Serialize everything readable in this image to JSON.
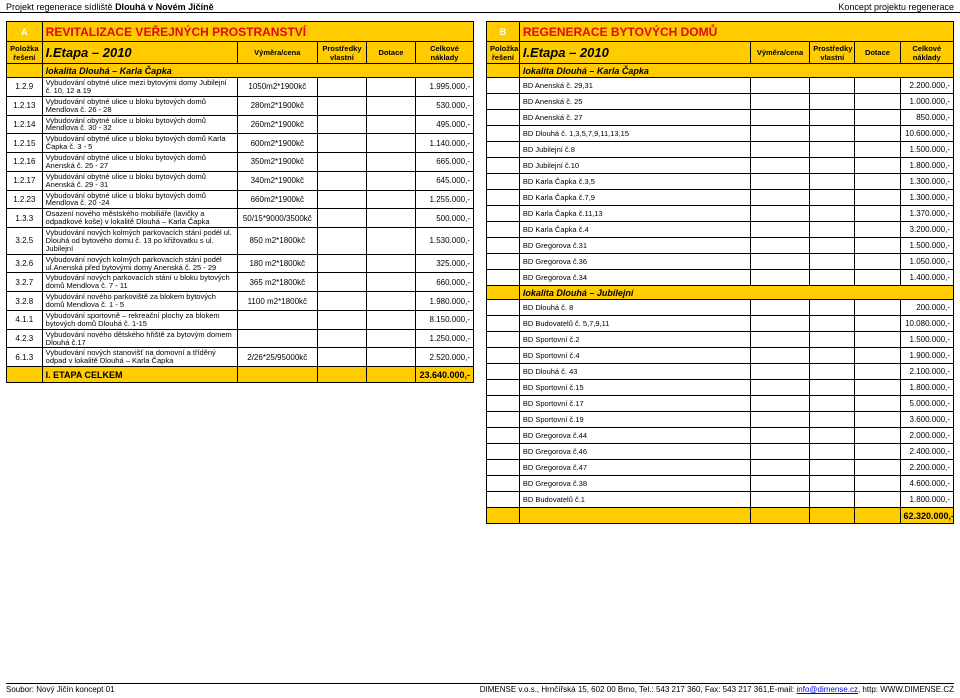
{
  "header": {
    "left_prefix": "Projekt regenerace sídliště ",
    "left_bold": "Dlouhá v Novém Jičíně",
    "right": "Koncept projektu regenerace"
  },
  "footer": {
    "left": "Soubor: Nový Jičín koncept 01",
    "right_plain": "DIMENSE v.o.s., Hrnčířská 15, 602 00 Brno, Tel.: 543 217 360, Fax: 543 217 361,E-mail: ",
    "right_link": "info@dimense.cz",
    "right_tail": ", http: WWW.DIMENSE.CZ"
  },
  "tableA": {
    "letter": "A",
    "title": "REVITALIZACE VEŘEJNÝCH PROSTRANSTVÍ",
    "etapa_label": "I.Etapa – 2010",
    "col_labels": {
      "polozka": "Položka řešení",
      "vymera": "Výměra/cena",
      "prostredky": "Prostředky vlastní",
      "dotace": "Dotace",
      "celkove": "Celkové náklady"
    },
    "sub1": "lokalita Dlouhá – Karla Čapka",
    "rows": [
      {
        "id": "1.2.9",
        "desc": "Vybudování obytné ulice mezi bytovými domy Jubilejní č. 10, 12 a 19",
        "rate": "1050m2*1900kč",
        "cost": "1.995.000,-"
      },
      {
        "id": "1.2.13",
        "desc": "Vybudování obytné ulice u bloku bytových domů Mendlova č. 26 - 28",
        "rate": "280m2*1900kč",
        "cost": "530.000,-"
      },
      {
        "id": "1.2.14",
        "desc": "Vybudování obytné ulice u bloku bytových domů Mendlova č. 30 - 32",
        "rate": "260m2*1900kč",
        "cost": "495.000,-"
      },
      {
        "id": "1.2.15",
        "desc": "Vybudování obytné ulice u bloku bytových domů Karla Čapka č. 3 - 5",
        "rate": "600m2*1900kč",
        "cost": "1.140.000,-"
      },
      {
        "id": "1.2.16",
        "desc": "Vybudování obytné ulice u bloku bytových domů Anenská č. 25 - 27",
        "rate": "350m2*1900kč",
        "cost": "665.000,-"
      },
      {
        "id": "1.2.17",
        "desc": "Vybudování obytné ulice u bloku bytových domů Anenská č. 29 - 31",
        "rate": "340m2*1900kč",
        "cost": "645.000,-"
      },
      {
        "id": "1.2.23",
        "desc": "Vybudování obytné ulice u bloku bytových domů Mendlova č. 20 -24",
        "rate": "660m2*1900kč",
        "cost": "1.255.000,-"
      },
      {
        "id": "1.3.3",
        "desc": "Osazení nového městského mobiliáře (lavičky a odpadkové koše) v lokalitě Dlouhá – Karla Čapka",
        "rate": "50/15*9000/3500kč",
        "cost": "500.000,-"
      },
      {
        "id": "3.2.5",
        "desc": "Vybudování nových kolmých parkovacích stání podél ul. Dlouhá od bytového domu č. 13 po křižovatku s ul. Jubilejní",
        "rate": "850 m2*1800kč",
        "cost": "1.530.000,-"
      },
      {
        "id": "3.2.6",
        "desc": "Vybudování nových kolmých parkovacích stání podél ul.Anenská před bytovými domy Anenská č. 25 - 29",
        "rate": "180 m2*1800kč",
        "cost": "325.000,-"
      },
      {
        "id": "3.2.7",
        "desc": "Vybudování nových parkovacích stání u bloku bytových domů Mendlova č. 7 - 11",
        "rate": "365 m2*1800kč",
        "cost": "660.000,-"
      },
      {
        "id": "3.2.8",
        "desc": "Vybudování nového parkoviště za blokem bytových domů Mendlova č. 1 - 5",
        "rate": "1100 m2*1800kč",
        "cost": "1.980.000,-"
      },
      {
        "id": "4.1.1",
        "desc": "Vybudování sportovně – rekreační plochy za blokem bytových domů Dlouhá č. 1-15",
        "rate": "",
        "cost": "8.150.000,-"
      },
      {
        "id": "4.2.3",
        "desc": "Vybudování nového dětského hřiště za bytovým domem Dlouhá č.17",
        "rate": "",
        "cost": "1.250.000,-"
      },
      {
        "id": "6.1.3",
        "desc": "Vybudování nových stanovišť na domovní a tříděný odpad v lokalitě Dlouhá – Karla Čapka",
        "rate": "2/26*25/95000kč",
        "cost": "2.520.000,-"
      }
    ],
    "total_label": "I. ETAPA CELKEM",
    "total_value": "23.640.000,-"
  },
  "tableB": {
    "letter": "B",
    "title": "REGENERACE BYTOVÝCH DOMŮ",
    "etapa_label": "I.Etapa – 2010",
    "col_labels": {
      "polozka": "Položka řešení",
      "vymera": "Výměra/cena",
      "prostredky": "Prostředky vlastní",
      "dotace": "Dotace",
      "celkove": "Celkové náklady"
    },
    "sub1": "lokalita Dlouhá – Karla Čapka",
    "rows1": [
      {
        "desc": "BD Anenská č. 29,31",
        "cost": "2.200.000,-"
      },
      {
        "desc": "BD Anenská č. 25",
        "cost": "1.000.000,-"
      },
      {
        "desc": "BD Anenská č. 27",
        "cost": "850.000,-"
      },
      {
        "desc": "BD Dlouhá č. 1,3,5,7,9,11,13,15",
        "cost": "10.600.000,-"
      },
      {
        "desc": "BD Jubilejní č.8",
        "cost": "1.500.000,-"
      },
      {
        "desc": "BD Jubilejní č.10",
        "cost": "1.800.000,-"
      },
      {
        "desc": "BD Karla Čapka č.3,5",
        "cost": "1.300.000,-"
      },
      {
        "desc": "BD Karla Čapka č.7,9",
        "cost": "1.300.000,-"
      },
      {
        "desc": "BD Karla Čapka č.11,13",
        "cost": "1.370.000,-"
      },
      {
        "desc": "BD Karla Čapka č.4",
        "cost": "3.200.000,-"
      },
      {
        "desc": "BD Gregorova č.31",
        "cost": "1.500.000,-"
      },
      {
        "desc": "BD Gregorova č.36",
        "cost": "1.050.000,-"
      },
      {
        "desc": "BD Gregorova č.34",
        "cost": "1.400.000,-"
      }
    ],
    "sub2": "lokalita Dlouhá – Jubilejní",
    "rows2": [
      {
        "desc": "BD Dlouhá č. 8",
        "cost": "200.000,-"
      },
      {
        "desc": "BD Budovatelů č. 5,7,9,11",
        "cost": "10.080.000,-"
      },
      {
        "desc": "BD Sportovní č.2",
        "cost": "1.500.000,-"
      },
      {
        "desc": "BD Sportovní č.4",
        "cost": "1.900.000,-"
      },
      {
        "desc": "BD Dlouhá č. 43",
        "cost": "2.100.000,-"
      },
      {
        "desc": "BD Sportovní č.15",
        "cost": "1.800.000,-"
      },
      {
        "desc": "BD Sportovní č.17",
        "cost": "5.000.000,-"
      },
      {
        "desc": "BD Sportovní č.19",
        "cost": "3.600.000,-"
      },
      {
        "desc": "BD Gregorova č.44",
        "cost": "2.000.000,-"
      },
      {
        "desc": "BD Gregorova č.46",
        "cost": "2.400.000,-"
      },
      {
        "desc": "BD Gregorova č.47",
        "cost": "2.200.000,-"
      },
      {
        "desc": "BD Gregorova č.38",
        "cost": "4.600.000,-"
      },
      {
        "desc": "BD Budovatelů č.1",
        "cost": "1.800.000,-"
      }
    ],
    "total_value": "62.320.000,-"
  }
}
